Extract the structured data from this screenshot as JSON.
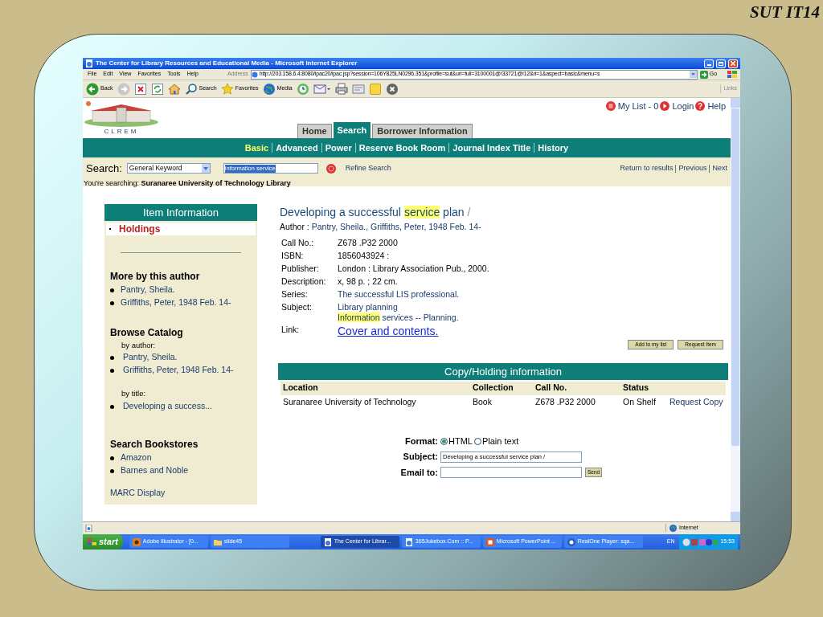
{
  "slide": {
    "title": "SUT IT14"
  },
  "window": {
    "title": "The Center for Library Resources and Educational Media - Microsoft Internet Explorer",
    "menu": [
      "File",
      "Edit",
      "View",
      "Favorites",
      "Tools",
      "Help"
    ],
    "address_label": "Address",
    "address": "http://203.158.6.4:8080/ipac20/ipac.jsp?session=106Y825LN0296.351&profile=sut&uri=full=3100001@!33721@!12&ri=1&aspect=basic&menu=s",
    "go": "Go",
    "toolbar": [
      {
        "kind": "back",
        "label": "Back"
      },
      {
        "kind": "forward"
      },
      {
        "kind": "stop"
      },
      {
        "kind": "refresh"
      },
      {
        "kind": "home"
      },
      {
        "kind": "search",
        "label": "Search"
      },
      {
        "kind": "favorites",
        "label": "Favorites"
      },
      {
        "kind": "media",
        "label": "Media"
      },
      {
        "kind": "history"
      },
      {
        "kind": "mail"
      },
      {
        "kind": "print"
      },
      {
        "kind": "edit"
      },
      {
        "kind": "note"
      },
      {
        "kind": "messenger"
      }
    ],
    "links": "Links"
  },
  "page": {
    "logo_text": "CLREM",
    "top_links": [
      {
        "kind": "list",
        "label": "My List - 0"
      },
      {
        "kind": "login",
        "label": "Login"
      },
      {
        "kind": "help",
        "label": "Help"
      }
    ],
    "tabs": [
      {
        "label": "Home",
        "selected": false
      },
      {
        "label": "Search",
        "selected": true
      },
      {
        "label": "Borrower Information",
        "selected": false
      }
    ],
    "subnav": [
      {
        "label": "Basic",
        "selected": true
      },
      {
        "label": "Advanced",
        "selected": false
      },
      {
        "label": "Power",
        "selected": false
      },
      {
        "label": "Reserve Book Room",
        "selected": false
      },
      {
        "label": "Journal Index Title",
        "selected": false
      },
      {
        "label": "History",
        "selected": false
      }
    ],
    "search": {
      "label": "Search:",
      "select": "General Keyword",
      "query": "information service",
      "refine": "Refine Search",
      "nav": [
        "Return to results",
        "Previous",
        "Next"
      ],
      "scope": "You're searching: **Suranaree University of Technology Library**"
    },
    "sidebar": {
      "header": "Item Information",
      "items": [
        {
          "label": "Holdings",
          "selected": true
        }
      ],
      "sections": [
        {
          "heading": "More by this author",
          "groups": [
            {
              "items": [
                "Pantry, Sheila.",
                "Griffiths, Peter, 1948 Feb. 14-"
              ]
            }
          ]
        },
        {
          "heading": "Browse Catalog",
          "groups": [
            {
              "label": "by author:",
              "items": [
                "Pantry, Sheila.",
                "Griffiths, Peter, 1948 Feb. 14-"
              ]
            },
            {
              "label": "by title:",
              "items": [
                "Developing a success..."
              ]
            }
          ]
        },
        {
          "heading": "Search Bookstores",
          "groups": [
            {
              "items": [
                "Amazon",
                "Barnes and Noble"
              ]
            }
          ]
        }
      ],
      "footer_link": "MARC Display"
    },
    "record": {
      "title": [
        {
          "text": "Developing a successful ",
          "highlight": false
        },
        {
          "text": "service",
          "highlight": true
        },
        {
          "text": " plan ",
          "highlight": false
        }
      ],
      "title_suffix": "/",
      "author_label": "Author : ",
      "author": "Pantry, Sheila., Griffiths, Peter, 1948 Feb. 14-",
      "fields": [
        {
          "label": "Call No.:",
          "kind": "text",
          "lines": [
            [
              {
                "text": "Z678 .P32 2000",
                "highlight": false
              }
            ]
          ]
        },
        {
          "label": "ISBN:",
          "kind": "text",
          "lines": [
            [
              {
                "text": "1856043924 :",
                "highlight": false
              }
            ]
          ]
        },
        {
          "label": "Publisher:",
          "kind": "text",
          "lines": [
            [
              {
                "text": "London : Library Association Pub., 2000.",
                "highlight": false
              }
            ]
          ]
        },
        {
          "label": "Description:",
          "kind": "text",
          "lines": [
            [
              {
                "text": "x, 98 p. ; 22 cm.",
                "highlight": false
              }
            ]
          ]
        },
        {
          "label": "Series:",
          "kind": "link",
          "lines": [
            [
              {
                "text": "The successful LIS professional.",
                "highlight": false
              }
            ]
          ]
        },
        {
          "label": "Subject:",
          "kind": "link",
          "lines": [
            [
              {
                "text": "Library planning",
                "highlight": false
              }
            ],
            [
              {
                "text": "Information",
                "highlight": true
              },
              {
                "text": " services -- Planning.",
                "highlight": false
              }
            ]
          ]
        },
        {
          "label": "Link:",
          "kind": "url",
          "lines": [
            [
              {
                "text": "Cover and contents.",
                "highlight": false
              }
            ]
          ]
        }
      ],
      "buttons": [
        "Add to my list",
        "Request Item"
      ]
    },
    "holdings": {
      "title": "Copy/Holding information",
      "columns": [
        "Location",
        "Collection",
        "Call No.",
        "Status"
      ],
      "rows": [
        {
          "location": "Suranaree University of Technology",
          "collection": "Book",
          "call_no": "Z678 .P32 2000",
          "status": "On Shelf",
          "action": "Request Copy"
        }
      ]
    },
    "email": {
      "format_label": "Format:",
      "formats": [
        {
          "label": "HTML",
          "selected": true
        },
        {
          "label": "Plain text",
          "selected": false
        }
      ],
      "subject_label": "Subject:",
      "subject": "Developing a successful service plan /",
      "email_label": "Email to:",
      "send": "Send"
    }
  },
  "status_bar": {
    "zone": "Internet"
  },
  "taskbar": {
    "start": "start",
    "tasks": [
      {
        "kind": "illustrator",
        "label": "Adobe Illustrator - [0...",
        "selected": false
      },
      {
        "kind": "folder",
        "label": "slide45",
        "selected": false
      },
      {
        "kind": "ie",
        "label": "The Center for Librar...",
        "selected": true
      },
      {
        "kind": "ie",
        "label": "365Jukebox.Com :: P...",
        "selected": false
      },
      {
        "kind": "powerpoint",
        "label": "Microsoft PowerPoint ...",
        "selected": false
      },
      {
        "kind": "realone",
        "label": "RealOne Player: sqa...",
        "selected": false
      }
    ],
    "lang": "EN",
    "clock": "15:53"
  }
}
